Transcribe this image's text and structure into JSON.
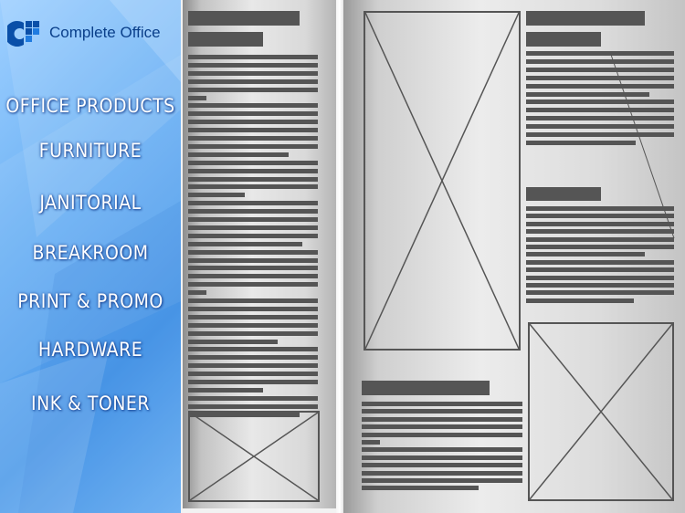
{
  "brand": {
    "name": "Complete Office",
    "color": "#0a3f8a"
  },
  "nav": {
    "items": [
      {
        "label": "OFFICE PRODUCTS"
      },
      {
        "label": "FURNITURE"
      },
      {
        "label": "JANITORIAL"
      },
      {
        "label": "BREAKROOM"
      },
      {
        "label": "PRINT & PROMO"
      },
      {
        "label": "HARDWARE"
      },
      {
        "label": "INK & TONER"
      }
    ]
  },
  "magazine": {
    "text_bar_color": "#555555",
    "image_placeholders": [
      "image-placeholder",
      "image-placeholder",
      "image-placeholder"
    ]
  }
}
